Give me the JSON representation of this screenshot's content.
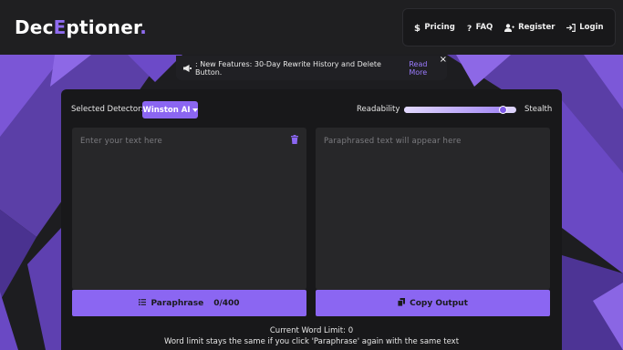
{
  "brand": {
    "name_prefix": "Dec",
    "name_highlight": "E",
    "name_suffix": "ptioner",
    "name_dot": ".",
    "accent_color": "#8b66f2"
  },
  "nav": {
    "items": [
      {
        "label": "Pricing",
        "icon": "dollar-icon"
      },
      {
        "label": "FAQ",
        "icon": "question-icon"
      },
      {
        "label": "Register",
        "icon": "user-plus-icon"
      },
      {
        "label": "Login",
        "icon": "login-icon"
      }
    ]
  },
  "banner": {
    "text": ": New Features: 30-Day Rewrite History and Delete Button.",
    "link": "Read More",
    "close": "×",
    "icon": "megaphone-icon"
  },
  "controls": {
    "detector_label": "Selected Detector:",
    "detector_value": "Winston AI",
    "readability_label": "Readability",
    "stealth_label": "Stealth",
    "slider_value": 0.88
  },
  "editor": {
    "input_placeholder": "Enter your text here",
    "output_placeholder": "Paraphrased text will appear here",
    "paraphrase_label": "Paraphrase",
    "word_count": "0/400",
    "copy_label": "Copy Output"
  },
  "footer": {
    "current_word_limit": "Current Word Limit: 0",
    "note": "Word limit stays the same if you click 'Paraphrase' again with the same text"
  }
}
